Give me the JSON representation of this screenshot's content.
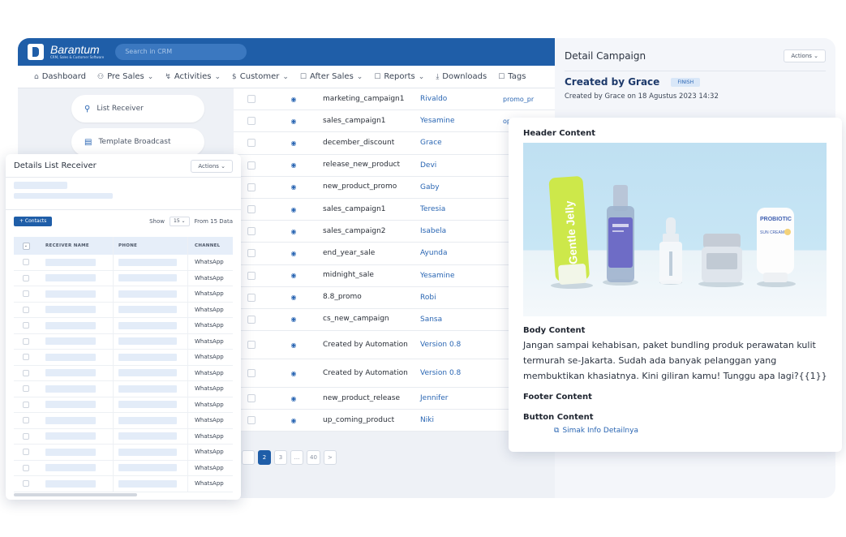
{
  "crm": {
    "brand_name": "Barantum",
    "brand_sub": "CRM, Sales & Customer Software",
    "search_placeholder": "Search in CRM",
    "nav": [
      {
        "label": "Dashboard",
        "icon": "home-icon",
        "glyph": "⌂"
      },
      {
        "label": "Pre Sales",
        "icon": "people-icon",
        "glyph": "⚇"
      },
      {
        "label": "Activities",
        "icon": "activity-icon",
        "glyph": "↯"
      },
      {
        "label": "Customer",
        "icon": "dollar-icon",
        "glyph": "$"
      },
      {
        "label": "After Sales",
        "icon": "folder-icon",
        "glyph": "☐"
      },
      {
        "label": "Reports",
        "icon": "folder-icon",
        "glyph": "☐"
      },
      {
        "label": "Downloads",
        "icon": "download-icon",
        "glyph": "⤓"
      },
      {
        "label": "Tags",
        "icon": "folder-icon",
        "glyph": "☐"
      }
    ],
    "side_items": [
      {
        "label": "List Receiver",
        "icon": "person-icon",
        "glyph": "⚲"
      },
      {
        "label": "Template Broadcast",
        "icon": "template-icon",
        "glyph": "▤"
      }
    ],
    "rows": [
      {
        "name": "marketing_campaign1",
        "user": "Rivaldo",
        "extra": "promo_pr"
      },
      {
        "name": "sales_campaign1",
        "user": "Yesamine",
        "extra": "opt_terba"
      },
      {
        "name": "december_discount",
        "user": "Grace",
        "extra": ""
      },
      {
        "name": "release_new_product",
        "user": "Devi",
        "extra": ""
      },
      {
        "name": "new_product_promo",
        "user": "Gaby",
        "extra": ""
      },
      {
        "name": "sales_campaign1",
        "user": "Teresia",
        "extra": ""
      },
      {
        "name": "sales_campaign2",
        "user": "Isabela",
        "extra": ""
      },
      {
        "name": "end_year_sale",
        "user": "Ayunda",
        "extra": ""
      },
      {
        "name": "midnight_sale",
        "user": "Yesamine",
        "extra": ""
      },
      {
        "name": "8.8_promo",
        "user": "Robi",
        "extra": ""
      },
      {
        "name": "cs_new_campaign",
        "user": "Sansa",
        "extra": ""
      },
      {
        "name": "Created by Automation",
        "user": "Version 0.8",
        "extra": "",
        "tall": true
      },
      {
        "name": "Created by Automation",
        "user": "Version 0.8",
        "extra": "",
        "tall": true
      },
      {
        "name": "new_product_release",
        "user": "Jennifer",
        "extra": ""
      },
      {
        "name": "up_coming_product",
        "user": "Niki",
        "extra": ""
      }
    ],
    "pagination": [
      "",
      "2",
      "3",
      "...",
      "40",
      ">"
    ],
    "pagination_active": 1
  },
  "detail": {
    "title": "Detail Campaign",
    "actions_label": "Actions ⌄",
    "created_by_title": "Created by Grace",
    "status": "FINISH",
    "created_on": "Created by Grace on 18 Agustus 2023 14:32"
  },
  "content": {
    "header_title": "Header Content",
    "body_title": "Body Content",
    "body_text": "Jangan sampai kehabisan, paket bundling produk perawatan kulit termurah se-Jakarta. Sudah ada banyak pelanggan yang membuktikan khasiatnya. Kini giliran kamu! Tunggu apa lagi?{{1}}",
    "footer_title": "Footer Content",
    "button_title": "Button Content",
    "link_label": "Simak Info Detailnya",
    "products": {
      "tube_text": "Gentle Jelly",
      "jar_text": "PROBIOTIC",
      "jar_sub": "SUN CREAM"
    }
  },
  "receiver": {
    "title": "Details List Receiver",
    "actions_label": "Actions ⌄",
    "contacts_button": "+ Contacts",
    "show_label": "Show",
    "show_value": "15 ⌄",
    "from_label": "From 15 Data",
    "columns": [
      "RECEIVER NAME",
      "PHONE",
      "CHANNEL"
    ],
    "channel_value": "WhatsApp",
    "row_count": 15
  },
  "colors": {
    "primary": "#1f5ea8",
    "link": "#2a66b3",
    "badge_bg": "#d9e7f8"
  }
}
